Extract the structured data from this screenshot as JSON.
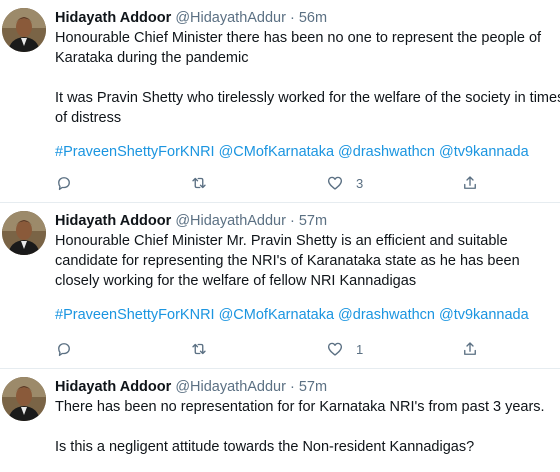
{
  "tweets": [
    {
      "name": "Hidayath Addoor",
      "handle": "@HidayathAddur",
      "separator": "·",
      "time": "56m",
      "text": "Honourable Chief Minister there has been no one to represent the people of Karataka during the pandemic\n\nIt was Pravin Shetty who tirelessly worked for the welfare of the society in times of distress",
      "hashtags": [
        "#PraveenShettyForKNRI",
        "@CMofKarnataka",
        "@drashwathcn",
        "@tv9kannada"
      ],
      "reply_count": "",
      "retweet_count": "",
      "like_count": "3"
    },
    {
      "name": "Hidayath Addoor",
      "handle": "@HidayathAddur",
      "separator": "·",
      "time": "57m",
      "text": "Honourable Chief Minister Mr. Pravin Shetty is an efficient and suitable candidate for representing the NRI's of Karanataka state as he has been closely working for the welfare of fellow NRI Kannadigas",
      "hashtags": [
        "#PraveenShettyForKNRI",
        "@CMofKarnataka",
        "@drashwathcn",
        "@tv9kannada"
      ],
      "reply_count": "",
      "retweet_count": "",
      "like_count": "1"
    },
    {
      "name": "Hidayath Addoor",
      "handle": "@HidayathAddur",
      "separator": "·",
      "time": "57m",
      "text": "There has been no representation for for Karnataka NRI's from past 3 years.\n\nIs this a negligent attitude towards the Non-resident Kannadigas?"
    }
  ],
  "colors": {
    "link": "#1b95e0",
    "muted": "#5b7083",
    "text": "#0f1419",
    "divider": "#e6ecf0"
  },
  "icons": {
    "reply": "reply-icon",
    "retweet": "retweet-icon",
    "like": "like-icon",
    "share": "share-icon"
  }
}
